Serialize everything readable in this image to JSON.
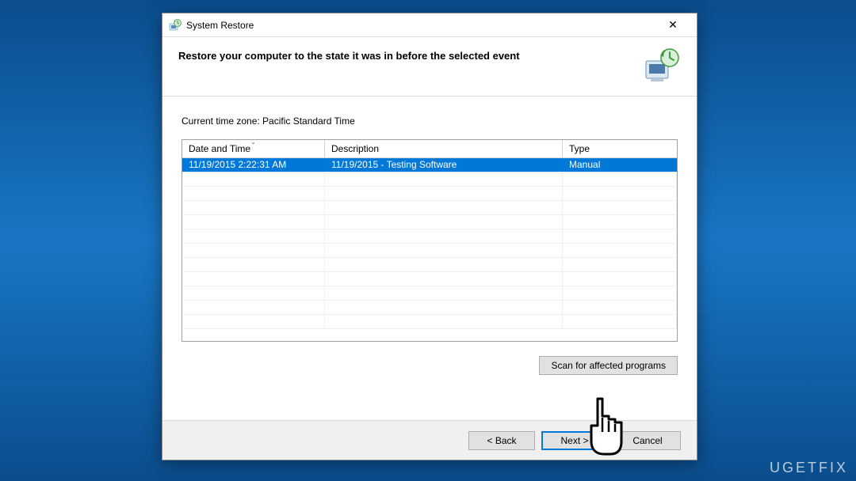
{
  "window": {
    "title": "System Restore"
  },
  "header": {
    "heading": "Restore your computer to the state it was in before the selected event"
  },
  "body": {
    "timezone_label": "Current time zone: Pacific Standard Time",
    "columns": {
      "datetime": "Date and Time",
      "description": "Description",
      "type": "Type"
    },
    "rows": [
      {
        "datetime": "11/19/2015 2:22:31 AM",
        "description": "11/19/2015 - Testing Software",
        "type": "Manual",
        "selected": true
      }
    ],
    "scan_button": "Scan for affected programs"
  },
  "footer": {
    "back": "< Back",
    "next": "Next >",
    "cancel": "Cancel"
  },
  "watermark": "UGETFIX"
}
